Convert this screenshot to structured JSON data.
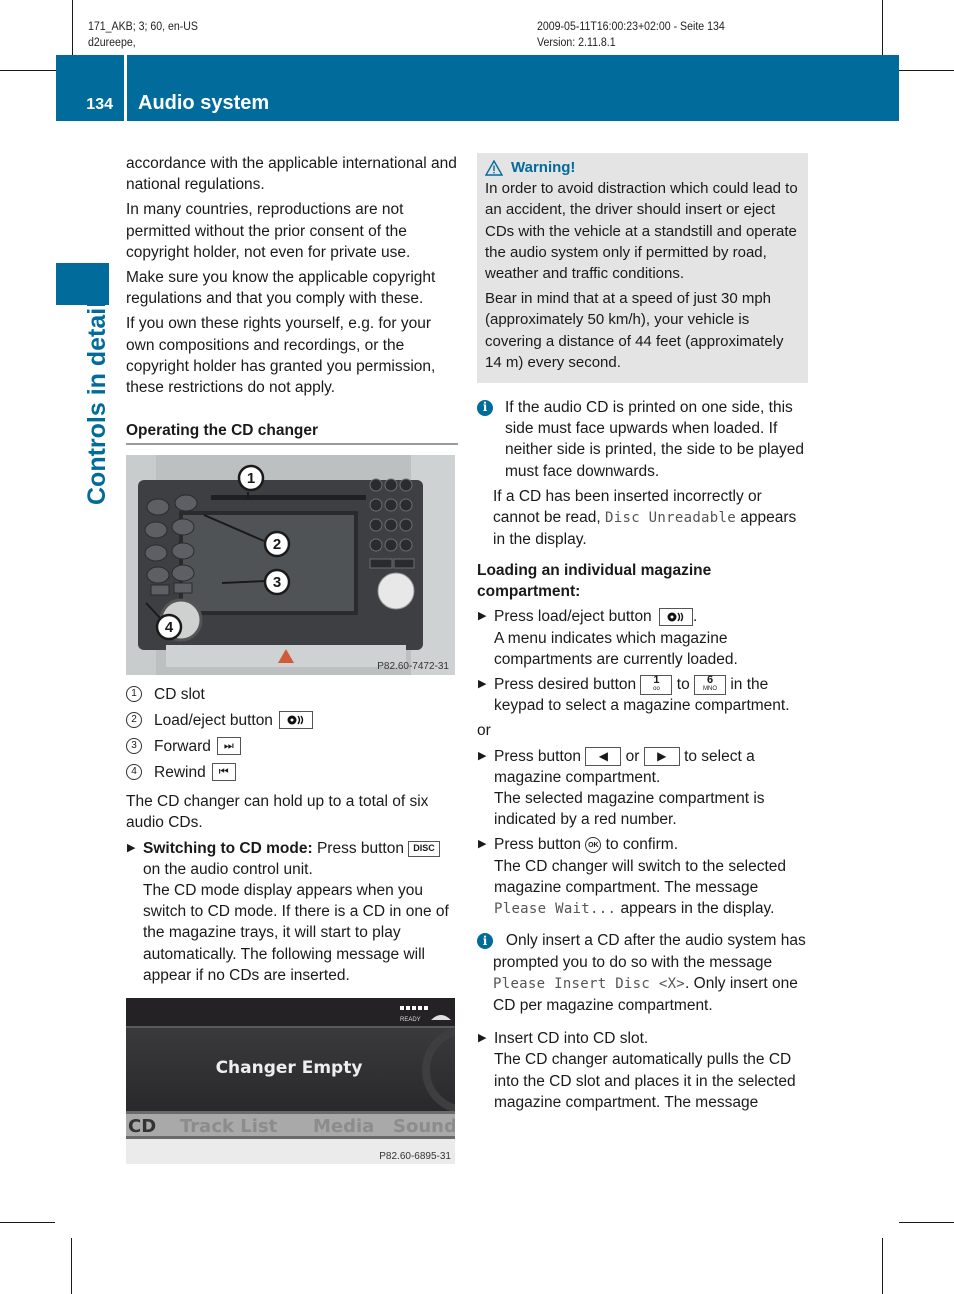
{
  "meta": {
    "top_left_line1": "171_AKB; 3; 60, en-US",
    "top_left_line2": "d2ureepe,",
    "top_right_line1": "2009-05-11T16:00:23+02:00 - Seite 134",
    "top_right_line2": "Version: 2.11.8.1"
  },
  "header": {
    "page_number": "134",
    "section_title": "Audio system",
    "side_label": "Controls in detail",
    "accent_color": "#016b9c"
  },
  "left": {
    "para1": "accordance with the applicable international and national regulations.",
    "para2": "In many countries, reproductions are not permitted without the prior consent of the copyright holder, not even for private use.",
    "para3": "Make sure you know the applicable copyright regulations and that you comply with these.",
    "para4": "If you own these rights yourself, e.g. for your own compositions and recordings, or the copyright holder has granted you permission, these restrictions do not apply.",
    "heading": "Operating the CD changer",
    "figure1": {
      "callouts": [
        "1",
        "2",
        "3",
        "4"
      ],
      "code": "P82.60-7472-31"
    },
    "legend": [
      {
        "num": "1",
        "label": "CD slot",
        "key": ""
      },
      {
        "num": "2",
        "label": "Load/eject button",
        "key": "load-eject"
      },
      {
        "num": "3",
        "label": "Forward",
        "key": "⏭"
      },
      {
        "num": "4",
        "label": "Rewind",
        "key": "⏮"
      }
    ],
    "capacity": "The CD changer can hold up to a total of six audio CDs.",
    "switch_bold": "Switching to CD mode:",
    "switch_text1": " Press button",
    "disc_key": "DISC",
    "switch_text2": " on the audio control unit.",
    "switch_text3": "The CD mode display appears when you switch to CD mode. If there is a CD in one of the magazine trays, it will start to play automatically. The following message will appear if no CDs are inserted.",
    "figure2": {
      "status": "READY",
      "message": "Changer Empty",
      "menu": [
        "CD",
        "Track List",
        "Media",
        "Sound"
      ],
      "code": "P82.60-6895-31"
    }
  },
  "right": {
    "warning": {
      "title": "Warning!",
      "para1": "In order to avoid distraction which could lead to an accident, the driver should insert or eject CDs with the vehicle at a standstill and operate the audio system only if permitted by road, weather and traffic conditions.",
      "para2": "Bear in mind that at a speed of just 30 mph (approximately 50 km/h), your vehicle is covering a distance of 44 feet (approximately 14 m) every second."
    },
    "info1": {
      "para1": "If the audio CD is printed on one side, this side must face upwards when loaded. If neither side is printed, the side to be played must face downwards.",
      "para2a": "If a CD has been inserted incorrectly or cannot be read, ",
      "para2_code": "Disc Unreadable",
      "para2b": " appears in the display."
    },
    "heading": "Loading an individual magazine compartment:",
    "step1a": "Press load/eject button",
    "step1b": ".",
    "step1c": "A menu indicates which magazine compartments are currently loaded.",
    "step2a": "Press desired button",
    "key1": {
      "num": "1",
      "sub": "oo"
    },
    "step2b": "to",
    "key6": {
      "num": "6",
      "sub": "MNO"
    },
    "step2c": "in the keypad to select a magazine compartment.",
    "or": "or",
    "step3a": "Press button",
    "left_key": "◀",
    "step3b": "or",
    "right_key": "▶",
    "step3c": "to select a magazine compartment.",
    "step3d": "The selected magazine compartment is indicated by a red number.",
    "step4a": "Press button",
    "ok_key": "OK",
    "step4b": "to confirm.",
    "step4c": "The CD changer will switch to the selected magazine compartment. The message ",
    "step4_code": "Please Wait...",
    "step4d": " appears in the display.",
    "info2": {
      "a": "Only insert a CD after the audio system has prompted you to do so with the message ",
      "code": "Please Insert Disc <X>",
      "b": ". Only insert one CD per magazine compartment."
    },
    "step5a": "Insert CD into CD slot.",
    "step5b": "The CD changer automatically pulls the CD into the CD slot and places it in the selected magazine compartment. The message"
  }
}
